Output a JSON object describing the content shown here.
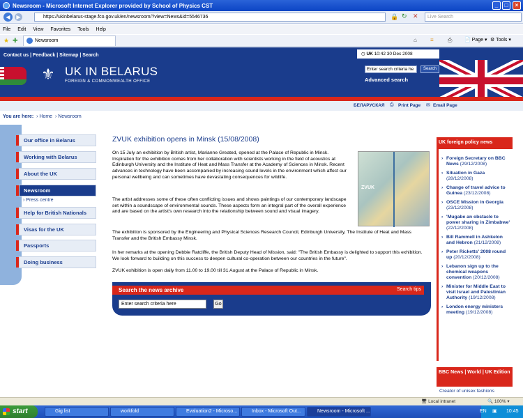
{
  "window": {
    "title": "Newsroom - Microsoft Internet Explorer provided by School of Physics CST",
    "url": "https://ukinbelarus-stage.fco.gov.uk/en/newsroom/?view=News&id=5546736",
    "live_search_placeholder": "Live Search",
    "tab_label": "Newsroom",
    "menu": [
      "File",
      "Edit",
      "View",
      "Favorites",
      "Tools",
      "Help"
    ],
    "cmd_page": "Page",
    "cmd_tools": "Tools",
    "status_zone": "Local intranet",
    "zoom": "100%"
  },
  "site": {
    "toplinks": "Contact us | Feedback | Sitemap | Search",
    "logo_main": "UK IN BELARUS",
    "logo_sub": "FOREIGN & COMMONWEALTH OFFICE",
    "datetime_country": "UK",
    "datetime": "10:42 30 Dec 2008",
    "search_placeholder": "Enter search criteria he",
    "search_button": "Search",
    "advanced_search": "Advanced search",
    "lang_link": "БЕЛАРУСКАЯ",
    "print_link": "Print Page",
    "email_link": "Email Page",
    "breadcrumb_prefix": "You are here:",
    "breadcrumb": [
      "Home",
      "Newsroom"
    ]
  },
  "nav": {
    "items": [
      "Our office in Belarus",
      "Working with Belarus",
      "About the UK",
      "Newsroom",
      "Help for British Nationals",
      "Visas for the UK",
      "Passports",
      "Doing business"
    ],
    "sub_item": "Press centre"
  },
  "article": {
    "title": "ZVUK exhibition opens in Minsk (15/08/2008)",
    "p1": "On 15 July an exhibition by British artist, Marianne Greated, opened at the Palace of Republic in Minsk. Inspiration for the exhibition comes from her collaboration with scientists working in the field of acoustics at Edinburgh University and the Institute of Heat and Mass Transfer at the Academy of Sciences in Minsk. Recent advances in technology have been accompanied by increasing sound levels in the environment which affect our personal wellbeing and can sometimes have devastating consequences for wildlife.",
    "p2": "The artist addresses some of these often conflicting issues and shows paintings of our contemporary landscape set within a soundscape of environmental sounds. These aspects form an integral part of the overall experience and are based on the artist's own research into the relationship between sound and visual imagery.",
    "p3": "The exhibition is sponsored by the Engineering and Physical Sciences Research Council, Edinburgh University, The Institute of Heat and Mass Transfer and the British Embassy Minsk.",
    "p4": "In her remarks at the opening Debbie Ratcliffe, the British Deputy Head of Mission, said: \"The British Embassy is delighted to support this exhibition. We look forward to building on this success to deepen cultural co-operation between our countries in the future\".",
    "p5": "ZVUK exhibition is open daily from 11.00 to 19.00 till 31 August at the Palace of Republic in Minsk.",
    "image_caption": "ZVUK"
  },
  "archive": {
    "title": "Search the news archive",
    "tips": "Search tips",
    "placeholder": "Enter search criteria here",
    "go": "Go"
  },
  "right": {
    "title": "UK foreign policy news",
    "items": [
      {
        "text": "Foreign Secretary on BBC News",
        "date": "(29/12/2008)"
      },
      {
        "text": "Situation in Gaza",
        "date": "(28/12/2008)"
      },
      {
        "text": "Change of travel advice to Guinea",
        "date": "(23/12/2008)"
      },
      {
        "text": "OSCE Mission in Georgia",
        "date": "(23/12/2008)"
      },
      {
        "text": "'Mugabe an obstacle to power sharing in Zimbabwe'",
        "date": "(22/12/2008)"
      },
      {
        "text": "Bill Rammell in Ashkelon and Hebron",
        "date": "(21/12/2008)"
      },
      {
        "text": "Peter Ricketts' 2008 round up",
        "date": "(20/12/2008)"
      },
      {
        "text": "Lebanon sign up to the chemical weapons convention",
        "date": "(20/12/2008)"
      },
      {
        "text": "Minister for Middle East to visit Israel and Palestinian Authority",
        "date": "(19/12/2008)"
      },
      {
        "text": "London energy ministers meeting",
        "date": "(19/12/2008)"
      }
    ],
    "bbc_title": "BBC News | World | UK Edition",
    "bbc_item": "Creator of unisex fashions"
  },
  "taskbar": {
    "start": "start",
    "items": [
      "Gig list",
      "workfold",
      "Evaluation2 - Microso...",
      "Inbox - Microsoft Out...",
      "Newsroom - Microsoft ..."
    ],
    "lang": "EN",
    "clock": "10:45"
  },
  "colors": {
    "navy": "#1a3c8c",
    "red": "#d9271b",
    "light": "#e7edf6"
  }
}
